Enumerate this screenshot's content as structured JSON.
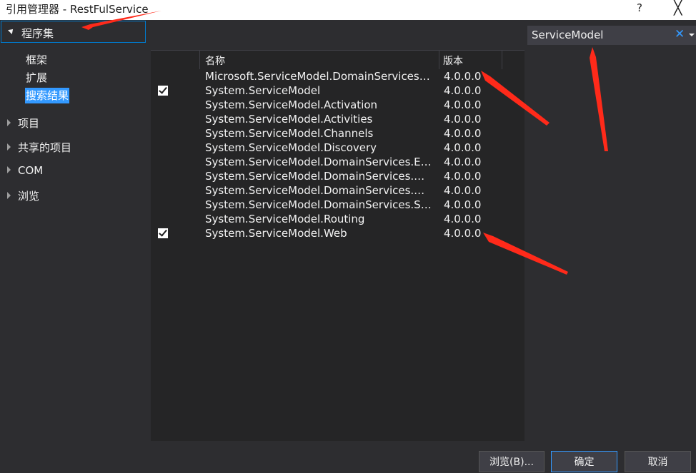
{
  "window": {
    "title": "引用管理器 - RestFulService",
    "help": "?",
    "close": "╳"
  },
  "nav": {
    "header": "程序集",
    "subitems": [
      "框架",
      "扩展",
      "搜索结果"
    ],
    "groups": [
      "项目",
      "共享的项目",
      "COM",
      "浏览"
    ]
  },
  "list": {
    "col_name": "名称",
    "col_version": "版本",
    "rows": [
      {
        "name": "Microsoft.ServiceModel.DomainServices.Hosting.OData",
        "version": "4.0.0.0",
        "checked": false
      },
      {
        "name": "System.ServiceModel",
        "version": "4.0.0.0",
        "checked": true
      },
      {
        "name": "System.ServiceModel.Activation",
        "version": "4.0.0.0",
        "checked": false
      },
      {
        "name": "System.ServiceModel.Activities",
        "version": "4.0.0.0",
        "checked": false
      },
      {
        "name": "System.ServiceModel.Channels",
        "version": "4.0.0.0",
        "checked": false
      },
      {
        "name": "System.ServiceModel.Discovery",
        "version": "4.0.0.0",
        "checked": false
      },
      {
        "name": "System.ServiceModel.DomainServices.EntityFramework",
        "version": "4.0.0.0",
        "checked": false
      },
      {
        "name": "System.ServiceModel.DomainServices.Hosting",
        "version": "4.0.0.0",
        "checked": false
      },
      {
        "name": "System.ServiceModel.DomainServices.Hosting.OData",
        "version": "4.0.0.0",
        "checked": false
      },
      {
        "name": "System.ServiceModel.DomainServices.Server",
        "version": "4.0.0.0",
        "checked": false
      },
      {
        "name": "System.ServiceModel.Routing",
        "version": "4.0.0.0",
        "checked": false
      },
      {
        "name": "System.ServiceModel.Web",
        "version": "4.0.0.0",
        "checked": true
      }
    ]
  },
  "search": {
    "value": "ServiceModel",
    "clear": "✕"
  },
  "buttons": {
    "browse": "浏览(B)...",
    "ok": "确定",
    "cancel": "取消"
  },
  "colors": {
    "accent": "#007acc",
    "selection": "#3399ff",
    "arrow": "#ff2a1a"
  }
}
